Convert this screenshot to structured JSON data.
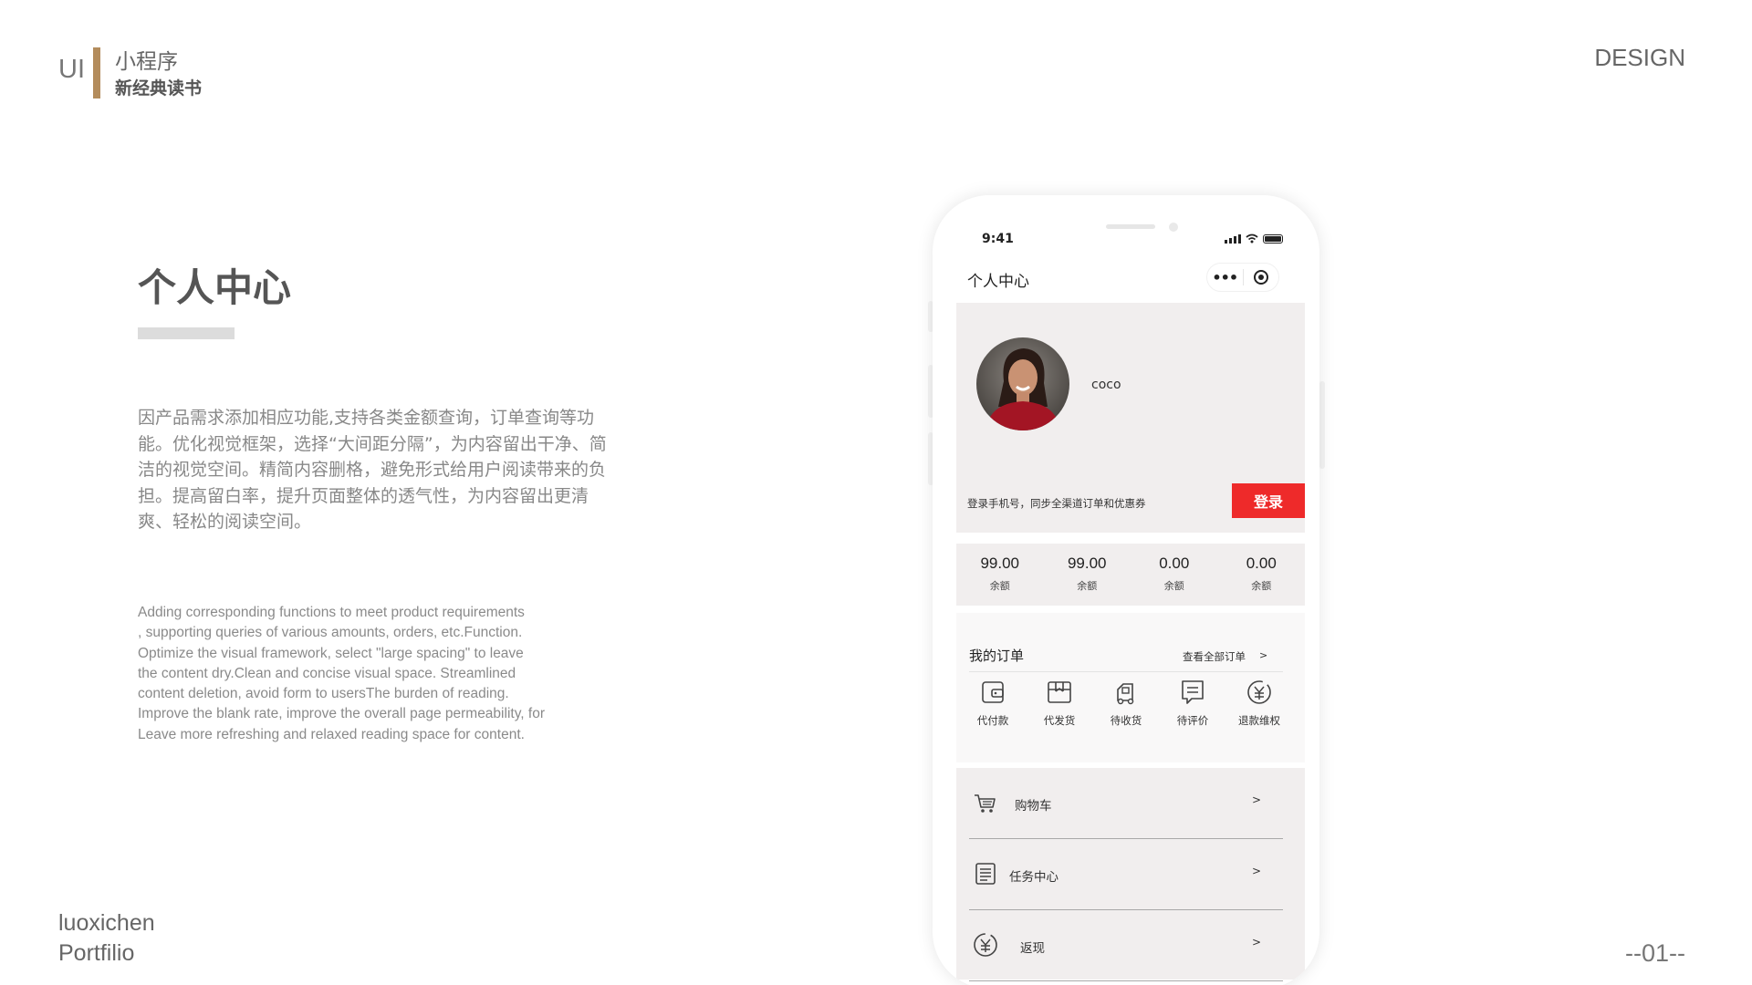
{
  "header": {
    "ui_label": "UI",
    "subtitle_1": "小程序",
    "subtitle_2": "新经典读书",
    "design_label": "DESIGN"
  },
  "content": {
    "title": "个人中心",
    "description_cn": "因产品需求添加相应功能,支持各类金额查询，订单查询等功能。优化视觉框架，选择“大间距分隔”，为内容留出干净、简洁的视觉空间。精简内容删格，避免形式给用户阅读带来的负担。提高留白率，提升页面整体的透气性，为内容留出更清爽、轻松的阅读空间。",
    "description_en": "Adding corresponding functions to meet product requirements\n, supporting queries of various amounts, orders, etc.Function.\n Optimize the visual framework, select \"large spacing\" to leave\n the content dry.Clean and concise visual space. Streamlined\ncontent deletion, avoid form to usersThe burden of reading.\nImprove the blank rate, improve the overall page permeability, for\nLeave more refreshing and relaxed reading space for content."
  },
  "footer": {
    "author": "luoxichen",
    "portfolio": "Portfilio",
    "page_number": "--01--"
  },
  "phone": {
    "status_time": "9:41",
    "nav_title": "个人中心",
    "capsule_more": "•••",
    "profile": {
      "username": "coco",
      "login_hint": "登录手机号，同步全渠道订单和优惠券",
      "login_button": "登录"
    },
    "balances": [
      {
        "value": "99.00",
        "label": "余额"
      },
      {
        "value": "99.00",
        "label": "余额"
      },
      {
        "value": "0.00",
        "label": "余额"
      },
      {
        "value": "0.00",
        "label": "余额"
      }
    ],
    "orders": {
      "title": "我的订单",
      "view_all": "查看全部订单",
      "chevron": ">",
      "items": [
        {
          "label": "代付款",
          "icon": "wallet-icon"
        },
        {
          "label": "代发货",
          "icon": "box-icon"
        },
        {
          "label": "待收货",
          "icon": "truck-icon"
        },
        {
          "label": "待评价",
          "icon": "comment-icon"
        },
        {
          "label": "退款维权",
          "icon": "refund-icon"
        }
      ]
    },
    "menu": [
      {
        "label": "购物车",
        "icon": "cart-icon",
        "chevron": ">"
      },
      {
        "label": "任务中心",
        "icon": "task-list-icon",
        "chevron": ">"
      },
      {
        "label": "返现",
        "icon": "cashback-icon",
        "chevron": ">"
      }
    ],
    "colors": {
      "login_red": "#ee2a2a",
      "panel_bg": "#f1eeee",
      "accent_gold": "#b38c5c"
    }
  }
}
